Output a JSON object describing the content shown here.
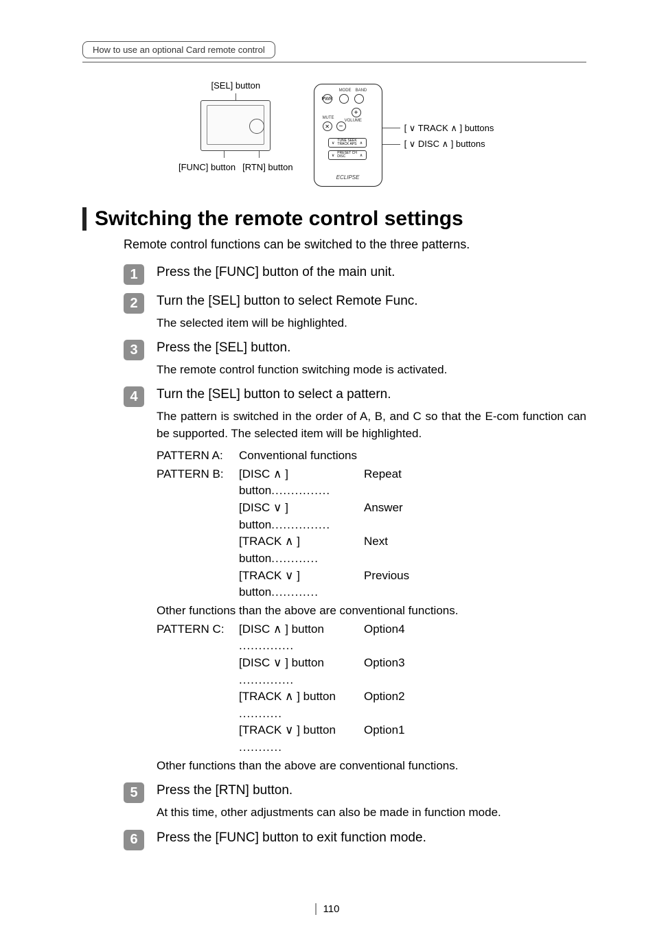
{
  "breadcrumb": "How to use an optional Card remote control",
  "figure": {
    "sel_label": "[SEL] button",
    "func_label": "[FUNC] button",
    "rtn_label": "[RTN] button",
    "track_callout": "[ ∨ TRACK ∧ ] buttons",
    "disc_callout": "[ ∨ DISC ∧ ] buttons",
    "remote_logo": "ECLIPSE"
  },
  "title": "Switching the remote control settings",
  "intro": "Remote control functions can be switched to the three patterns.",
  "steps": {
    "s1": {
      "head": "Press the [FUNC] button of the main unit."
    },
    "s2": {
      "head": "Turn the [SEL] button to select Remote Func.",
      "sub": "The selected item will be highlighted."
    },
    "s3": {
      "head": "Press the [SEL] button.",
      "sub": "The remote control function switching mode is activated."
    },
    "s4": {
      "head": "Turn the [SEL] button to select a pattern.",
      "sub": "The pattern is switched in the order of A, B, and C so that the E-com function can be supported. The selected item will be highlighted.",
      "patA_label": "PATTERN A:",
      "patA_desc": "Conventional functions",
      "patB_label": "PATTERN B:",
      "patB": [
        {
          "btn": "[DISC ∧ ] button",
          "act": "Repeat"
        },
        {
          "btn": "[DISC ∨ ] button",
          "act": "Answer"
        },
        {
          "btn": "[TRACK ∧ ] button",
          "act": "Next"
        },
        {
          "btn": "[TRACK ∨ ] button",
          "act": "Previous"
        }
      ],
      "other": "Other functions than the above are conventional functions.",
      "patC_label": "PATTERN C:",
      "patC": [
        {
          "btn": "[DISC ∧ ] button",
          "act": "Option4"
        },
        {
          "btn": "[DISC ∨ ] button",
          "act": "Option3"
        },
        {
          "btn": "[TRACK ∧ ] button",
          "act": "Option2"
        },
        {
          "btn": "[TRACK ∨ ] button",
          "act": "Option1"
        }
      ]
    },
    "s5": {
      "head": "Press the [RTN] button.",
      "sub": "At this time, other adjustments can also be made in function mode."
    },
    "s6": {
      "head": "Press the [FUNC] button to exit function mode."
    }
  },
  "page_number": "110"
}
